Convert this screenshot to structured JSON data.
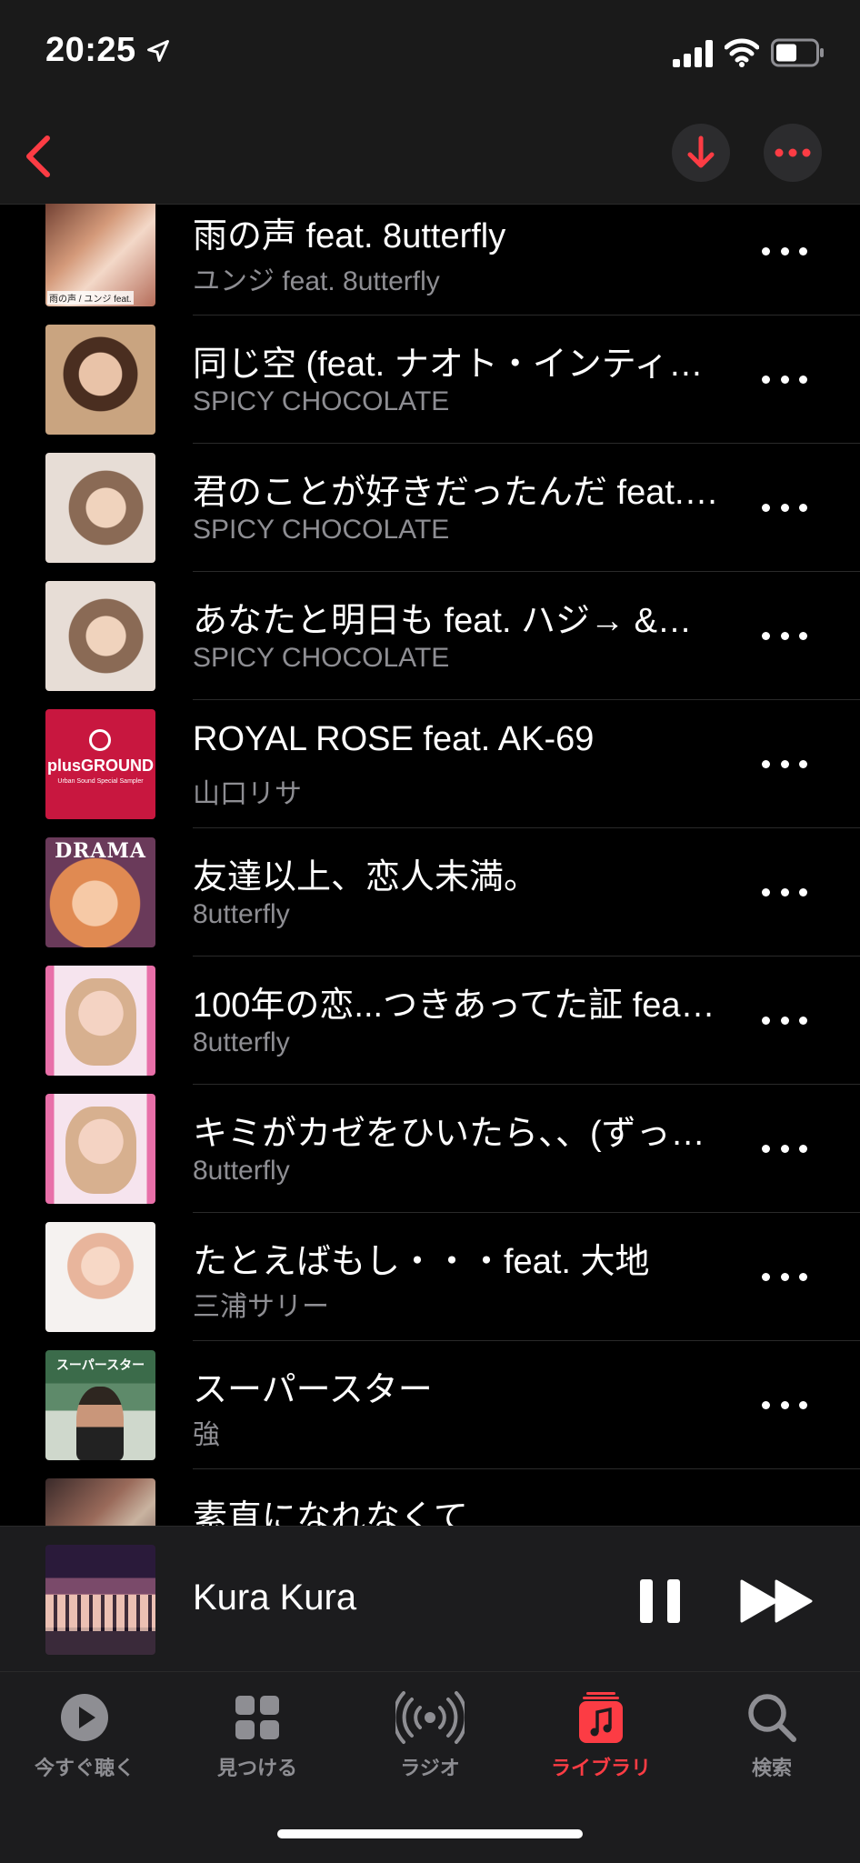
{
  "status_bar": {
    "time": "20:25"
  },
  "songs": [
    {
      "title": "雨の声 feat. 8utterfly",
      "artist": "ユンジ feat. 8utterfly",
      "art_label": "雨の声 / ユンジ feat."
    },
    {
      "title": "同じ空 (feat. ナオト・インティ…",
      "artist": "SPICY CHOCOLATE",
      "art_label": ""
    },
    {
      "title": "君のことが好きだったんだ feat.…",
      "artist": "SPICY CHOCOLATE",
      "art_label": ""
    },
    {
      "title": "あなたと明日も feat. ハジ→ &…",
      "artist": "SPICY CHOCOLATE",
      "art_label": ""
    },
    {
      "title": "ROYAL ROSE feat. AK-69",
      "artist": "山口リサ",
      "art_label": "plusGROUND"
    },
    {
      "title": "友達以上、恋人未満。",
      "artist": "8utterfly",
      "art_label": "DRAMA"
    },
    {
      "title": "100年の恋...つきあってた証 fea…",
      "artist": "8utterfly",
      "art_label": ""
    },
    {
      "title": "キミがカゼをひいたら、、(ずっ…",
      "artist": "8utterfly",
      "art_label": ""
    },
    {
      "title": "たとえばもし・・・feat. 大地",
      "artist": "三浦サリー",
      "art_label": ""
    },
    {
      "title": "スーパースター",
      "artist": "強",
      "art_label": "スーパースター"
    },
    {
      "title": "素直になれなくて",
      "artist": "",
      "art_label": ""
    }
  ],
  "art_sublabel": "Urban Sound Special Sampler",
  "mini_player": {
    "title": "Kura Kura"
  },
  "tabs": [
    {
      "label": "今すぐ聴く",
      "icon": "play-circle-icon"
    },
    {
      "label": "見つける",
      "icon": "grid-icon"
    },
    {
      "label": "ラジオ",
      "icon": "radio-icon"
    },
    {
      "label": "ライブラリ",
      "icon": "library-icon"
    },
    {
      "label": "検索",
      "icon": "search-icon"
    }
  ],
  "colors": {
    "accent": "#fc3c44",
    "background": "#000000",
    "secondary_text": "#8e8e93"
  }
}
